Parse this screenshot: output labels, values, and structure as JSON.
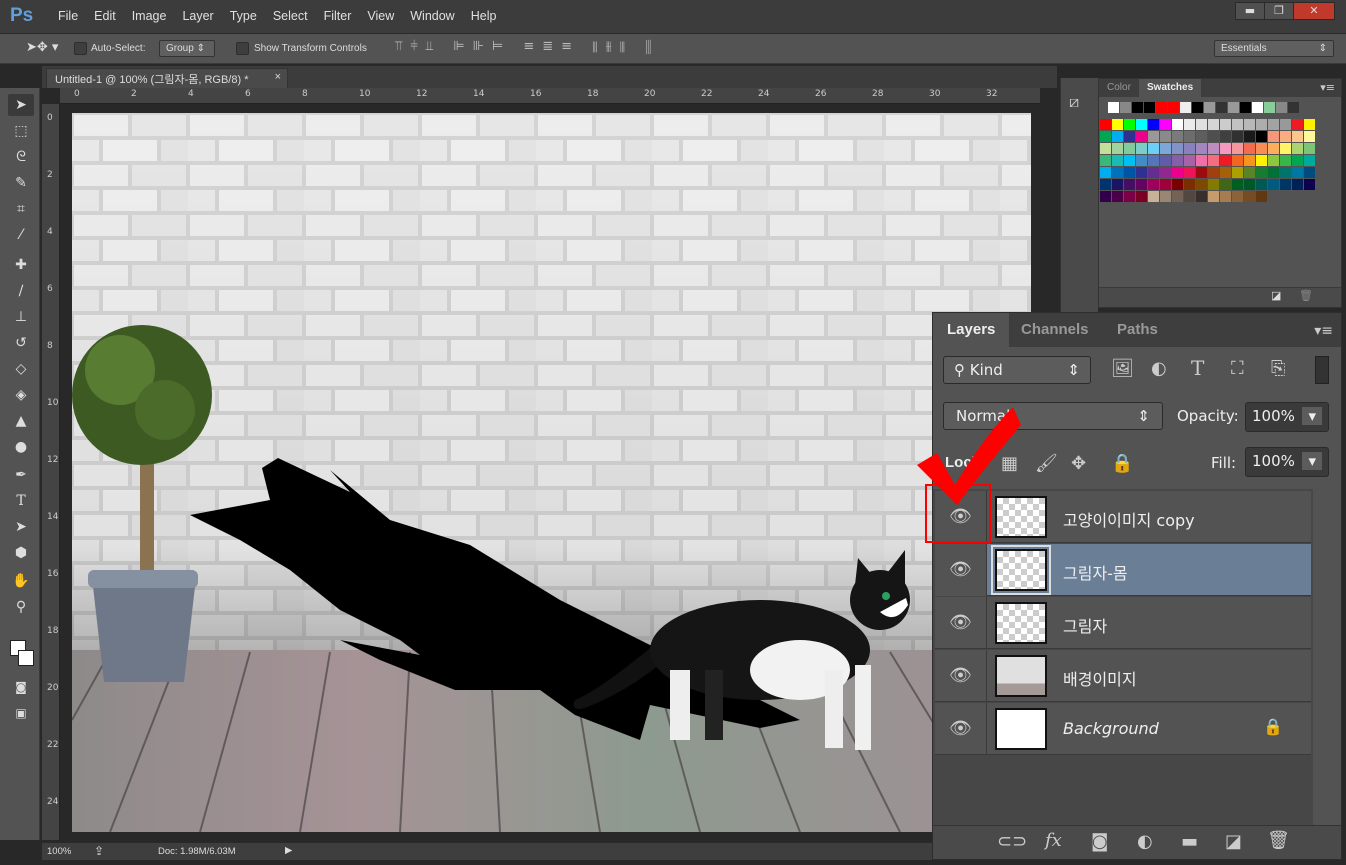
{
  "app": {
    "logo": "Ps",
    "menus": [
      "File",
      "Edit",
      "Image",
      "Layer",
      "Type",
      "Select",
      "Filter",
      "View",
      "Window",
      "Help"
    ],
    "window_controls": [
      "▬",
      "❐",
      "✕"
    ]
  },
  "options": {
    "auto_select": "Auto-Select:",
    "auto_select_target": "Group",
    "show_transform": "Show Transform Controls",
    "workspace": "Essentials"
  },
  "document": {
    "tab_title": "Untitled-1 @ 100% (그림자-몸, RGB/8) *",
    "close": "×",
    "zoom": "100%",
    "doc_info": "Doc: 1.98M/6.03M"
  },
  "rulers": {
    "top": [
      "0",
      "2",
      "4",
      "6",
      "8",
      "10",
      "12",
      "14",
      "16",
      "18",
      "20",
      "22",
      "24",
      "26",
      "28",
      "30",
      "32"
    ],
    "left": [
      "0",
      "2",
      "4",
      "6",
      "8",
      "10",
      "12",
      "14",
      "16",
      "18",
      "20",
      "22",
      "24"
    ]
  },
  "tools": [
    "move-tool",
    "marquee-tool",
    "lasso-tool",
    "quick-select-tool",
    "crop-tool",
    "eyedropper-tool",
    "healing-brush-tool",
    "brush-tool",
    "clone-stamp-tool",
    "history-brush-tool",
    "eraser-tool",
    "paint-bucket-tool",
    "blur-tool",
    "dodge-tool",
    "pen-tool",
    "type-tool",
    "path-selection-tool",
    "shape-tool",
    "hand-tool",
    "zoom-tool"
  ],
  "swatches_panel": {
    "tabs": [
      "Color",
      "Swatches"
    ],
    "active_tab": "Swatches",
    "recent": [
      "#ffffff",
      "#888888",
      "#000000",
      "#000000",
      "#ff0000",
      "#ff0000",
      "#eeeeee",
      "#000000",
      "#999999",
      "#333333",
      "#999999",
      "#000000",
      "#ffffff",
      "#88cc99",
      "#888888",
      "#333333"
    ],
    "grid": [
      [
        "#ff0000",
        "#ffff00",
        "#00ff00",
        "#00ffff",
        "#0000ff",
        "#ff00ff",
        "#ffffff",
        "#ebebeb",
        "#e0e0e0",
        "#d6d6d6",
        "#cccccc",
        "#c2c2c2",
        "#b8b8b8",
        "#adadad",
        "#a3a3a3",
        "#999999",
        "#ed1c24",
        "#fff200"
      ],
      [
        "#00a651",
        "#00aeef",
        "#2e3192",
        "#ec008c",
        "#999999",
        "#8a8a8a",
        "#7b7b7b",
        "#6d6d6d",
        "#5e5e5e",
        "#4f4f4f",
        "#404040",
        "#313131",
        "#1a1a1a",
        "#000000",
        "#f7977a",
        "#f9ad81",
        "#fdc68a",
        "#fff79a"
      ],
      [
        "#c4df9b",
        "#a3d39c",
        "#82ca9d",
        "#7bcdc8",
        "#6dcff6",
        "#7da7d9",
        "#8393ca",
        "#8781bd",
        "#a187be",
        "#bc8dbf",
        "#f49ac1",
        "#f5989d",
        "#f26c4f",
        "#f68e55",
        "#fbaf5c",
        "#fff467",
        "#acd372",
        "#7cc576"
      ],
      [
        "#3bb878",
        "#1abbb4",
        "#00bff3",
        "#438cca",
        "#5574b9",
        "#605ca8",
        "#855fa8",
        "#a763a8",
        "#f06ea9",
        "#f26d7d",
        "#ed1c24",
        "#f26522",
        "#f7941d",
        "#fff200",
        "#8dc63f",
        "#39b54a",
        "#00a651",
        "#00a99d"
      ],
      [
        "#00aeef",
        "#0072bc",
        "#0054a6",
        "#2e3192",
        "#662d91",
        "#92278f",
        "#ec008c",
        "#ed145b",
        "#9e0b0f",
        "#a0410d",
        "#a36209",
        "#aba000",
        "#598527",
        "#197b30",
        "#007236",
        "#00746b",
        "#0076a3",
        "#004b80"
      ],
      [
        "#003471",
        "#1b1464",
        "#440e62",
        "#630460",
        "#9e005d",
        "#9e0039",
        "#790000",
        "#7b2e00",
        "#7d4900",
        "#827b00",
        "#406618",
        "#005e20",
        "#005826",
        "#005952",
        "#005b7f",
        "#003663",
        "#002157",
        "#0d004c"
      ],
      [
        "#32004b",
        "#4b0049",
        "#7b0046",
        "#7a0026",
        "#c7b299",
        "#998675",
        "#736357",
        "#534741",
        "#362f2d",
        "#c69c6d",
        "#a67c52",
        "#8c6239",
        "#754c24",
        "#603913"
      ]
    ]
  },
  "layers_panel": {
    "tabs": [
      "Layers",
      "Channels",
      "Paths"
    ],
    "active_tab": "Layers",
    "filter": "Kind",
    "blend_mode": "Normal",
    "opacity_label": "Opacity:",
    "opacity": "100%",
    "fill_label": "Fill:",
    "fill": "100%",
    "lock_label": "Lock:",
    "layers": [
      {
        "name": "고양이이미지 copy",
        "visible": true,
        "selected": false,
        "highlighted": true
      },
      {
        "name": "그림자-몸",
        "visible": true,
        "selected": true
      },
      {
        "name": "그림자",
        "visible": true,
        "selected": false
      },
      {
        "name": "배경이미지",
        "visible": true,
        "selected": false
      },
      {
        "name": "Background",
        "visible": true,
        "selected": false,
        "locked": true
      }
    ],
    "footer_icons": [
      "link-icon",
      "fx-icon",
      "mask-icon",
      "adjustment-icon",
      "folder-icon",
      "new-layer-icon",
      "trash-icon"
    ]
  },
  "annotation": {
    "color": "#ff0000"
  }
}
